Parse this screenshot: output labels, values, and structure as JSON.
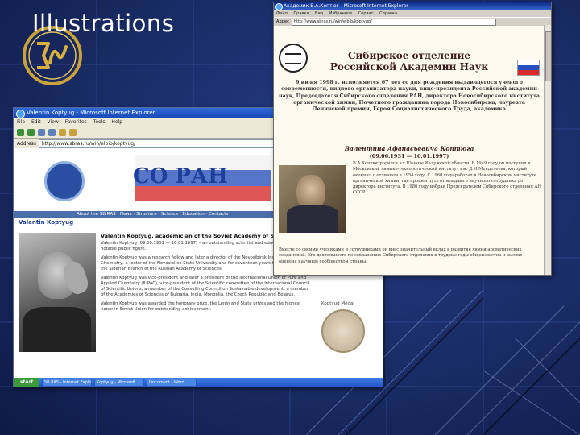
{
  "slide": {
    "title": "Illustrations"
  },
  "window_english": {
    "title_bar": "Valentin Koptyug - Microsoft Internet Explorer",
    "menu": [
      "File",
      "Edit",
      "View",
      "Favorites",
      "Tools",
      "Help"
    ],
    "address_label": "Address",
    "address": "http://www.sbras.ru/win/elbib/koptyug/",
    "go_label": "Go",
    "banner_text": "СО РАН",
    "nav_text": "About the SB RAS · News · Structure · Science · Education · Contacts",
    "page_heading": "Valentin Koptyug",
    "article_heading": "Valentin Koptyug, academician of the Soviet Academy of Sciences",
    "paragraphs": [
      "Valentin Koptyug (09.06.1931 — 10.01.1997) – an outstanding scientist and educationalist, a notable public figure.",
      "Valentin Koptyug was a research fellow and later a director of the Novosibirsk Institute of Organic Chemistry, a rector of the Novosibirsk State University and for seventeen years the chairman of the Siberian Branch of the Russian Academy of Sciences.",
      "Valentin Koptyug was vice-president and later a president of the International Union of Pure and Applied Chemistry (IUPAC), vice-president of the Scientific committee of the International Council of Scientific Unions, a member of the Consulting Council on Sustainable development, a member of the Academies of Sciences of Bulgaria, India, Mongolia, the Czech Republic and Belarus.",
      "Valentin Koptyug was awarded the honorary prize, the Lenin and State prizes and the highest honor in Soviet Union for outstanding achievement."
    ],
    "side_note": "Koptyug Medal",
    "start_label": "start",
    "tasks": [
      "SB RAS - Internet Explorer",
      "Koptyug - Microsoft",
      "Document - Word"
    ]
  },
  "window_russian": {
    "title_bar": "Академик В.А.Коптюг - Microsoft Internet Explorer",
    "menu": [
      "Файл",
      "Правка",
      "Вид",
      "Избранное",
      "Сервис",
      "Справка"
    ],
    "address_label": "Адрес",
    "address": "http://www.sbras.ru/win/elbib/koptyug/",
    "header_line1": "Сибирское отделение",
    "header_line2": "Российской Академии Наук",
    "intro": "9 июня 1998 г. исполняется 67 лет со дня рождения выдающегося ученого современности, видного организатора науки, вице-президента Российской академии наук, Председателя Сибирского отделения РАН, директора Новосибирского института органической химии, Почетного гражданина города Новосибирска, лауреата Ленинской премии, Героя Социалистического Труда, академика",
    "name": "Валентина Афанасьевича Коптюга",
    "dates": "(09.06.1931 — 10.01.1997)",
    "bio": "В.А.Коптюг родился в г.Юхнове Калужской области. В 1949 году он поступил в Московский химико-технологический институт им. Д.И.Менделеева, который окончил с отличием в 1954 году. С 1960 года работал в Новосибирском институте органической химии, где прошел путь от младшего научного сотрудника до директора института. В 1980 году избран Председателем Сибирского отделения АН СССР.",
    "bottom": "Вместе со своими учениками и сотрудниками он внес значительный вклад в развитие химии ароматических соединений. Его деятельность по сохранению Сибирского отделения в трудные годы общеизвестна и высоко оценена научным сообществом страны."
  }
}
